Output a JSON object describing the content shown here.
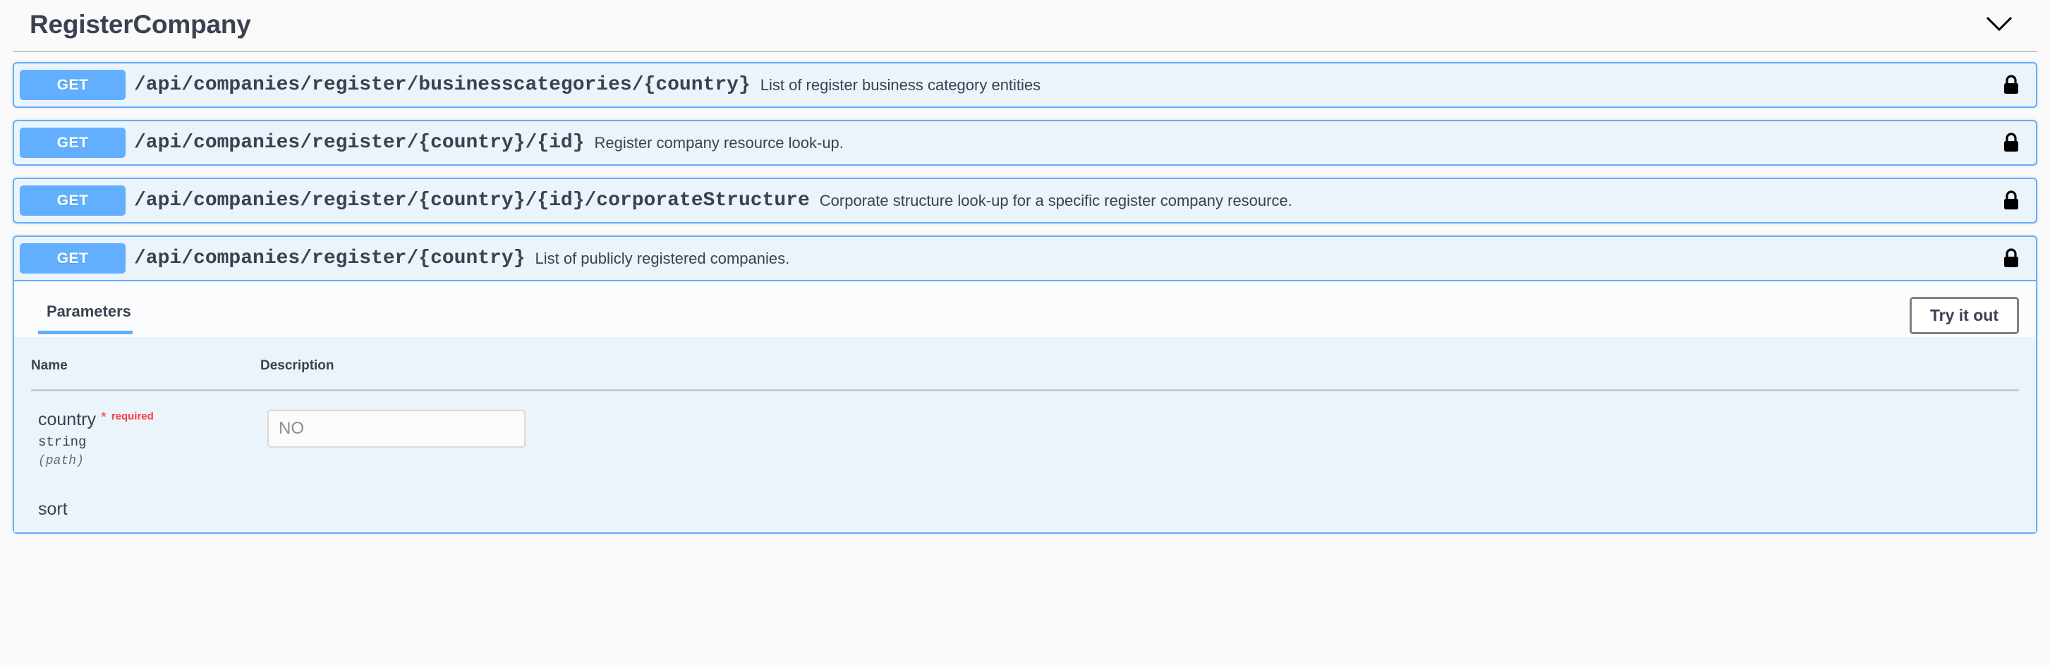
{
  "tag": {
    "title": "RegisterCompany",
    "collapse_icon": "chevron-down-icon"
  },
  "operations": [
    {
      "method": "GET",
      "path": "/api/companies/register/businesscategories/{country}",
      "summary": "List of register business category entities",
      "auth_icon": "lock-icon",
      "expanded": false
    },
    {
      "method": "GET",
      "path": "/api/companies/register/{country}/{id}",
      "summary": "Register company resource look-up.",
      "auth_icon": "lock-icon",
      "expanded": false
    },
    {
      "method": "GET",
      "path": "/api/companies/register/{country}/{id}/corporateStructure",
      "summary": "Corporate structure look-up for a specific register company resource.",
      "auth_icon": "lock-icon",
      "expanded": false
    },
    {
      "method": "GET",
      "path": "/api/companies/register/{country}",
      "summary": "List of publicly registered companies.",
      "auth_icon": "lock-icon",
      "expanded": true
    }
  ],
  "expanded_panel": {
    "tab_label": "Parameters",
    "try_it_out_label": "Try it out",
    "table_headers": {
      "name": "Name",
      "description": "Description"
    },
    "parameters": [
      {
        "name": "country",
        "required_marker": "*",
        "required_label": "required",
        "type": "string",
        "location": "(path)",
        "input_value": "",
        "input_placeholder": "NO"
      },
      {
        "name": "sort",
        "required_marker": "",
        "required_label": "",
        "type": "",
        "location": "",
        "input_value": "",
        "input_placeholder": ""
      }
    ]
  },
  "colors": {
    "get_method": "#61affe",
    "operation_bg": "#ebf3fb",
    "operation_border": "#61affe",
    "text_primary": "#3b4151",
    "required_red": "#f93e3e",
    "page_bg": "#fafafa"
  }
}
